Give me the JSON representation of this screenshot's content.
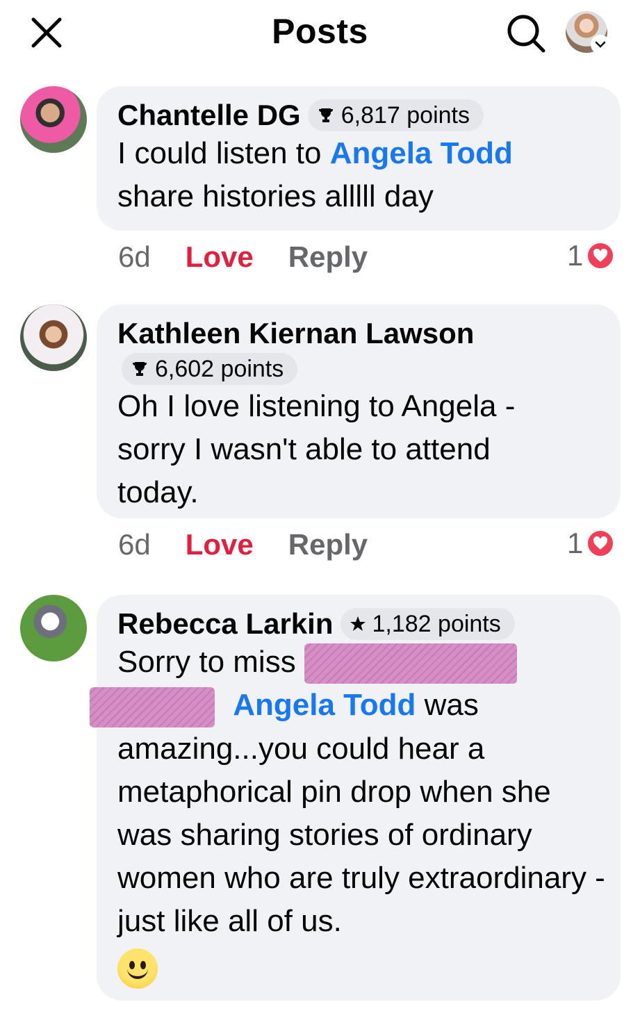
{
  "header": {
    "title": "Posts",
    "close_icon": "close-icon",
    "search_icon": "search-icon"
  },
  "comments": [
    {
      "author": "Chantelle DG",
      "badge_icon": "trophy-icon",
      "points": "6,817 points",
      "text_before": "I could listen to",
      "mention": "Angela Todd",
      "text_after": "share histories alllll day",
      "time": "6d",
      "love_label": "Love",
      "reply_label": "Reply",
      "reaction_count": "1"
    },
    {
      "author": "Kathleen Kiernan Lawson",
      "badge_icon": "trophy-icon",
      "points": "6,602 points",
      "text": "Oh I love listening to Angela - sorry I wasn't able to attend today.",
      "time": "6d",
      "love_label": "Love",
      "reply_label": "Reply",
      "reaction_count": "1"
    },
    {
      "author": "Rebecca Larkin",
      "badge_icon": "star-icon",
      "points": "1,182 points",
      "text_before": "Sorry to miss",
      "mention": "Angela Todd",
      "text_after": "was amazing...you could hear a metaphorical pin drop when she was sharing stories of ordinary women who are truly extraordinary - just like all of us.",
      "emoji": "🙂"
    }
  ],
  "colors": {
    "mention": "#1877f2",
    "love": "#e41e3f",
    "bubble": "#f0f2f5",
    "heart": "#f33e58"
  }
}
